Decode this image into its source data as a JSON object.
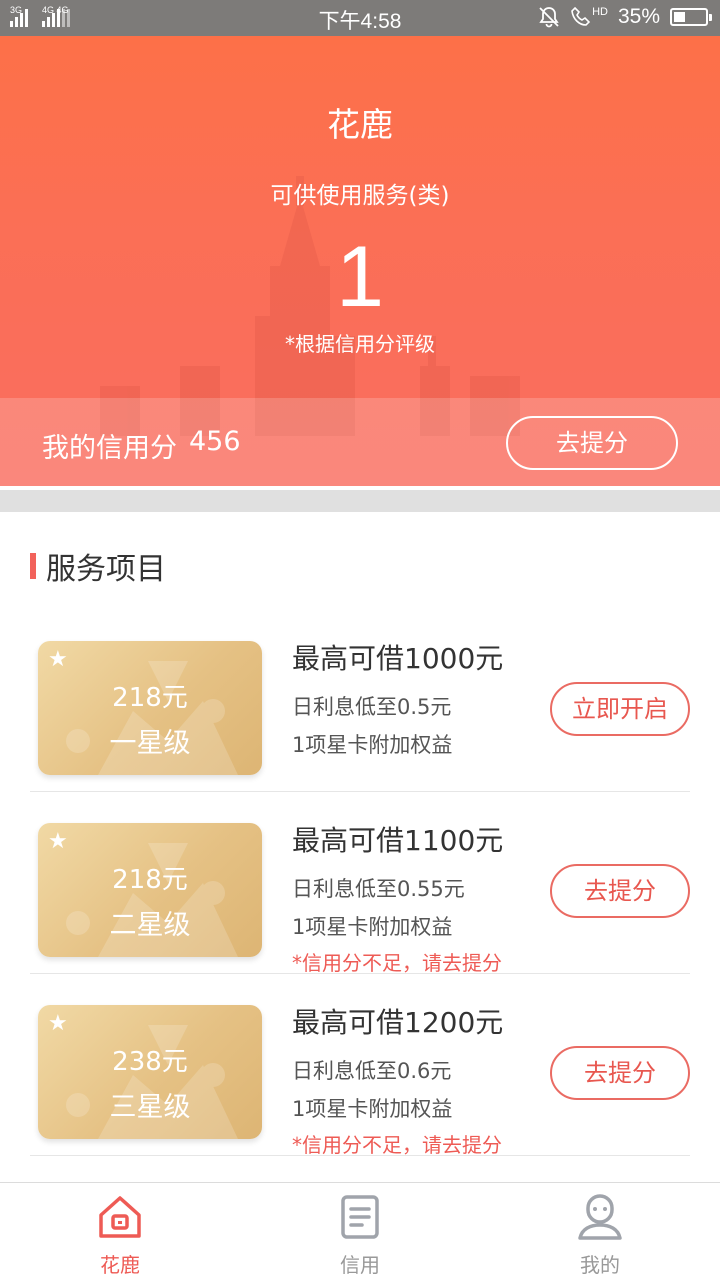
{
  "status_bar": {
    "net1": "3G",
    "net2": "4G 4G",
    "time": "下午4:58",
    "hd": "HD",
    "battery": "35%",
    "battery_level": 0.35
  },
  "header": {
    "title": "花鹿",
    "subtitle": "可供使用服务(类)",
    "count": "1",
    "note": "*根据信用分评级"
  },
  "credit": {
    "label": "我的信用分",
    "score": "456",
    "button": "去提分"
  },
  "section": {
    "title": "服务项目"
  },
  "services": [
    {
      "card_price": "218元",
      "card_level": "一星级",
      "title": "最高可借1000元",
      "interest": "日利息低至0.5元",
      "benefit": "1项星卡附加权益",
      "warning": "",
      "button": "立即开启"
    },
    {
      "card_price": "218元",
      "card_level": "二星级",
      "title": "最高可借1100元",
      "interest": "日利息低至0.55元",
      "benefit": "1项星卡附加权益",
      "warning": "*信用分不足，请去提分",
      "button": "去提分"
    },
    {
      "card_price": "238元",
      "card_level": "三星级",
      "title": "最高可借1200元",
      "interest": "日利息低至0.6元",
      "benefit": "1项星卡附加权益",
      "warning": "*信用分不足，请去提分",
      "button": "去提分"
    }
  ],
  "nav": {
    "items": [
      {
        "label": "花鹿",
        "icon": "home-icon",
        "active": true
      },
      {
        "label": "信用",
        "icon": "document-icon",
        "active": false
      },
      {
        "label": "我的",
        "icon": "profile-icon",
        "active": false
      }
    ]
  },
  "colors": {
    "accent": "#ee5b55",
    "hero": "#fb6f55",
    "card_gold": "#e5c184"
  }
}
